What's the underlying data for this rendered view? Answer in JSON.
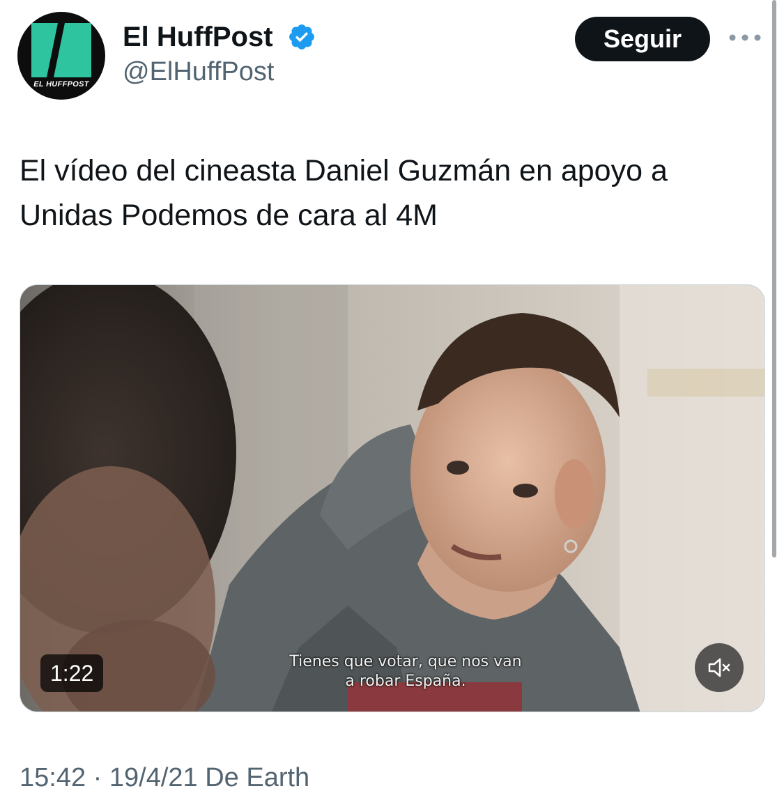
{
  "account": {
    "display_name": "El HuffPost",
    "handle": "@ElHuffPost",
    "avatar_logo_text": "EL HUFFPOST",
    "verified": true
  },
  "actions": {
    "follow_label": "Seguir",
    "more_icon": "more-horizontal-icon"
  },
  "tweet": {
    "text": "El vídeo del cineasta Daniel Guzmán en apoyo a Unidas Podemos de cara al 4M"
  },
  "media": {
    "type": "video",
    "duration": "1:22",
    "subtitle": "Tienes que votar, que nos van\na robar España.",
    "mute_icon": "volume-muted-icon"
  },
  "meta": {
    "time": "15:42",
    "separator": "·",
    "date": "19/4/21",
    "source": "De Earth"
  },
  "colors": {
    "text_primary": "#0f1419",
    "text_secondary": "#536471",
    "verified_blue": "#1d9bf0",
    "logo_green": "#2ec4a0",
    "button_bg": "#0f1419"
  }
}
